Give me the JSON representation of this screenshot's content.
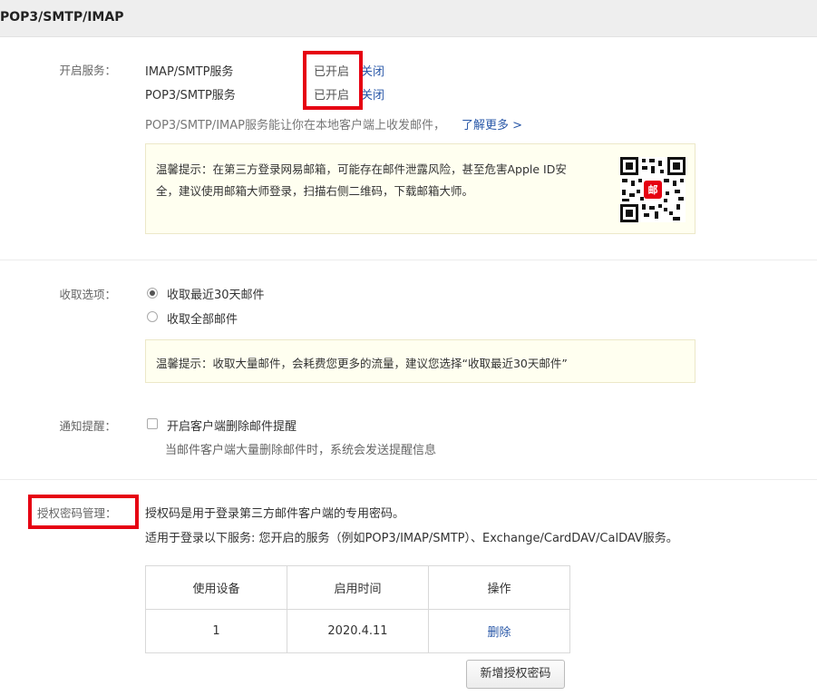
{
  "header": {
    "title": "POP3/SMTP/IMAP"
  },
  "services": {
    "label": "开启服务：",
    "items": [
      {
        "name": "IMAP/SMTP服务",
        "status": "已开启",
        "action": "关闭"
      },
      {
        "name": "POP3/SMTP服务",
        "status": "已开启",
        "action": "关闭"
      }
    ],
    "description": "POP3/SMTP/IMAP服务能让你在本地客户端上收发邮件，",
    "learn_more": "了解更多 >",
    "tip_line1": "温馨提示：在第三方登录网易邮箱，可能存在邮件泄露风险，甚至危害Apple ID安",
    "tip_line2": "全，建议使用邮箱大师登录，扫描右侧二维码，下载邮箱大师。",
    "qr_badge": "邮"
  },
  "fetch": {
    "label": "收取选项：",
    "options": [
      "收取最近30天邮件",
      "收取全部邮件"
    ],
    "selected_index": 0,
    "tip": "温馨提示：收取大量邮件，会耗费您更多的流量，建议您选择“收取最近30天邮件”"
  },
  "notify": {
    "label": "通知提醒：",
    "checkbox_label": "开启客户端删除邮件提醒",
    "checked": false,
    "hint": "当邮件客户端大量删除邮件时，系统会发送提醒信息"
  },
  "auth": {
    "label": "授权密码管理：",
    "desc1": "授权码是用于登录第三方邮件客户端的专用密码。",
    "desc2": "适用于登录以下服务: 您开启的服务（例如POP3/IMAP/SMTP）、Exchange/CardDAV/CalDAV服务。",
    "table": {
      "headers": [
        "使用设备",
        "启用时间",
        "操作"
      ],
      "rows": [
        {
          "device": "1",
          "time": "2020.4.11",
          "action": "删除"
        }
      ]
    },
    "add_button": "新增授权密码"
  },
  "colors": {
    "highlight": "#e60012",
    "link": "#2a58a8",
    "tip_bg": "#fffff0"
  }
}
